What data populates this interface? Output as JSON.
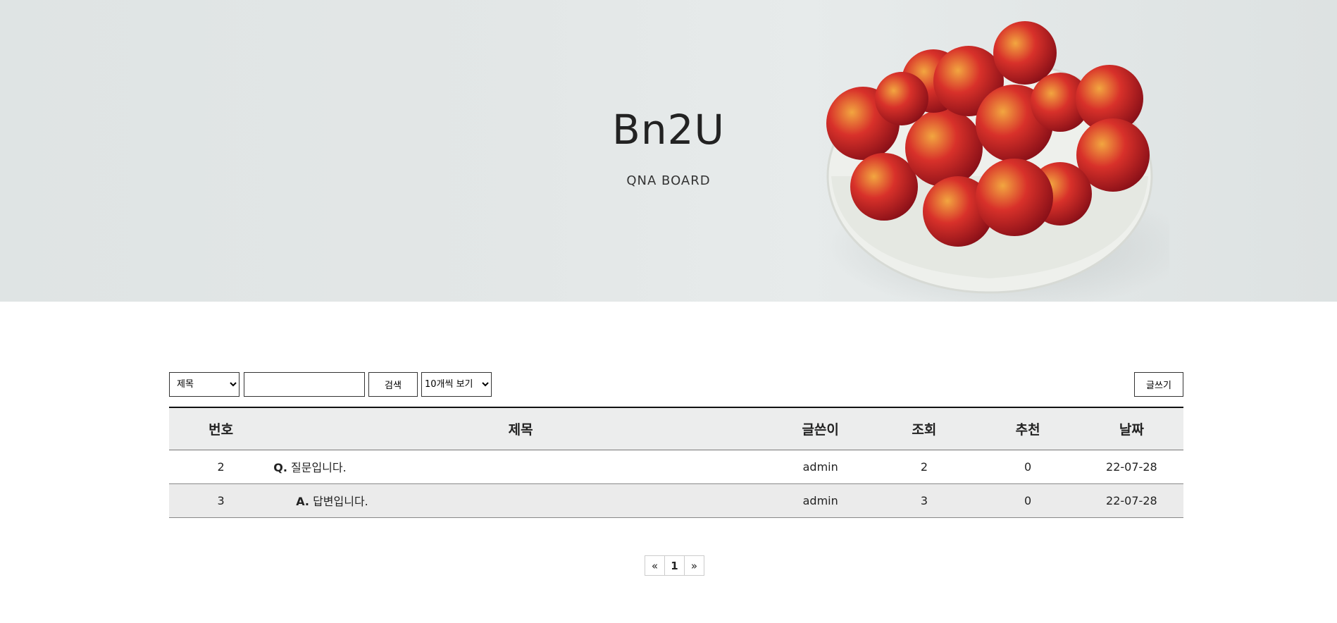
{
  "hero": {
    "title": "Bn2U",
    "subtitle": "QNA BOARD"
  },
  "search": {
    "field_selected": "제목",
    "field_options": [
      "제목"
    ],
    "query": "",
    "button_label": "검색",
    "count_selected": "10개씩 보기",
    "count_options": [
      "10개씩 보기"
    ]
  },
  "write_button": "글쓰기",
  "table": {
    "headers": [
      "번호",
      "제목",
      "글쓴이",
      "조회",
      "추천",
      "날짜"
    ],
    "rows": [
      {
        "no": "2",
        "mark": "Q.",
        "title": "질문입니다.",
        "author": "admin",
        "views": "2",
        "likes": "0",
        "date": "22-07-28"
      },
      {
        "no": "3",
        "mark": "A.",
        "title": "답변입니다.",
        "author": "admin",
        "views": "3",
        "likes": "0",
        "date": "22-07-28"
      }
    ]
  },
  "pagination": {
    "prev": "«",
    "current": "1",
    "next": "»"
  }
}
